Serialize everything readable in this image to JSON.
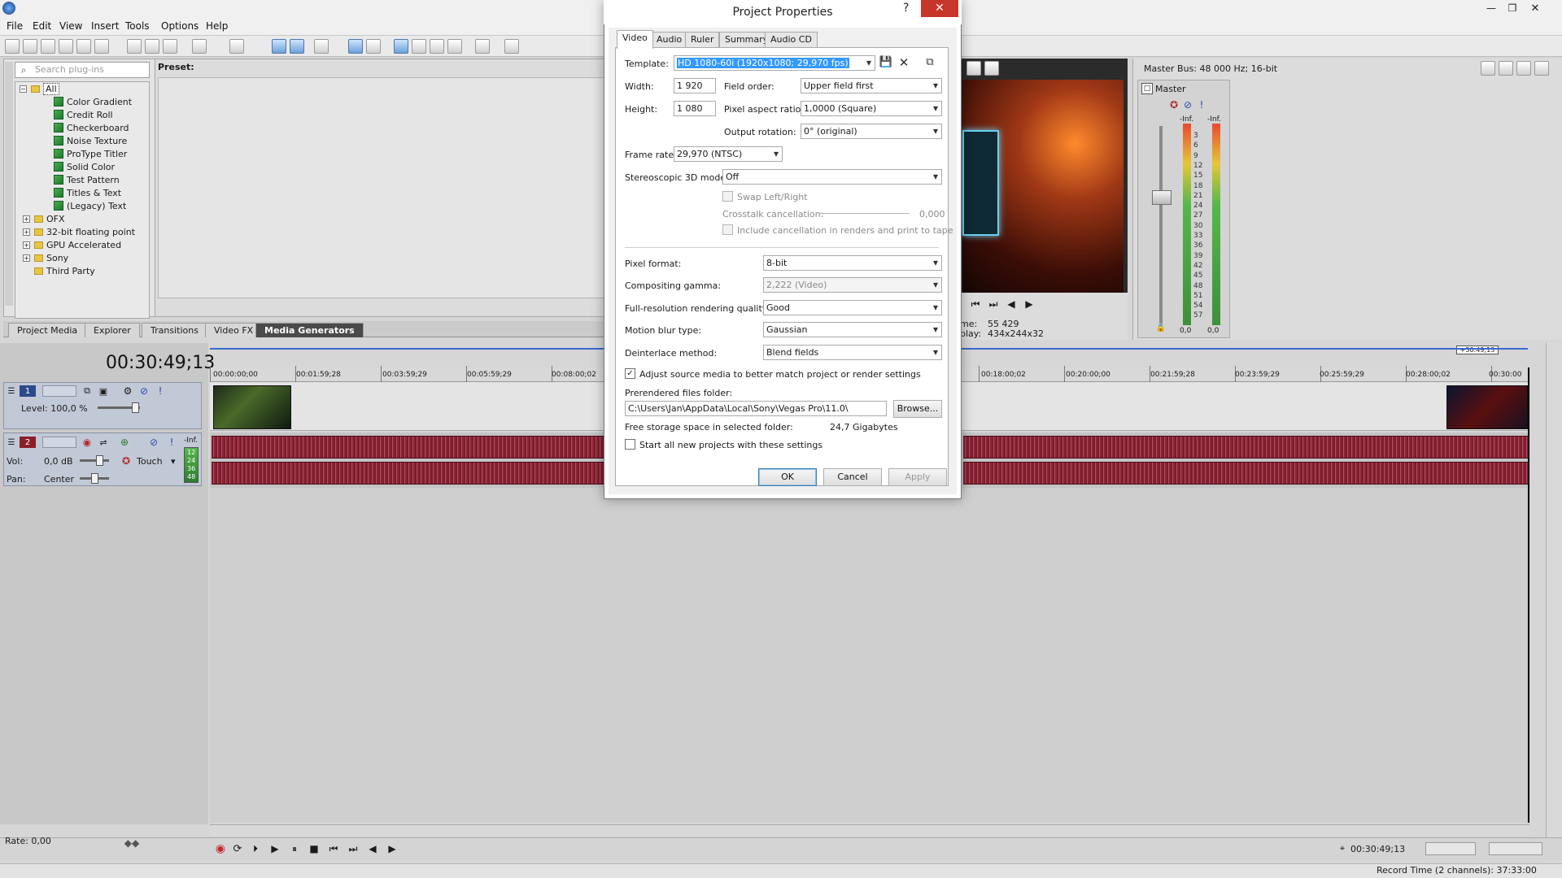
{
  "menu": [
    "File",
    "Edit",
    "View",
    "Insert",
    "Tools",
    "Options",
    "Help"
  ],
  "plugins": {
    "search_placeholder": "Search plug-ins",
    "preset_label": "Preset:",
    "tree": [
      {
        "label": "All",
        "kind": "folder",
        "expanded": true,
        "selected": true
      },
      {
        "label": "Color Gradient",
        "kind": "gen"
      },
      {
        "label": "Credit Roll",
        "kind": "gen"
      },
      {
        "label": "Checkerboard",
        "kind": "gen"
      },
      {
        "label": "Noise Texture",
        "kind": "gen"
      },
      {
        "label": "ProType Titler",
        "kind": "gen"
      },
      {
        "label": "Solid Color",
        "kind": "gen"
      },
      {
        "label": "Test Pattern",
        "kind": "gen"
      },
      {
        "label": "Titles & Text",
        "kind": "gen"
      },
      {
        "label": "(Legacy) Text",
        "kind": "gen"
      },
      {
        "label": "OFX",
        "kind": "folder"
      },
      {
        "label": "32-bit floating point",
        "kind": "folder"
      },
      {
        "label": "GPU Accelerated",
        "kind": "folder"
      },
      {
        "label": "Sony",
        "kind": "folder"
      },
      {
        "label": "Third Party",
        "kind": "folder"
      }
    ]
  },
  "window_tabs": [
    "Project Media",
    "Explorer",
    "Transitions",
    "Video FX",
    "Media Generators"
  ],
  "preview": {
    "frame_label": "me:",
    "frame_value": "55 429",
    "display_label": "play:",
    "display_value": "434x244x32"
  },
  "mixer": {
    "title": "Master Bus: 48 000 Hz; 16-bit",
    "master_label": "Master",
    "inf_left": "-Inf.",
    "inf_right": "-Inf.",
    "db_scale": [
      "3",
      "6",
      "9",
      "12",
      "15",
      "18",
      "21",
      "24",
      "27",
      "30",
      "33",
      "36",
      "39",
      "42",
      "45",
      "48",
      "51",
      "54",
      "57"
    ],
    "zero_left": "0,0",
    "zero_right": "0,0"
  },
  "timeline": {
    "timecode": "00:30:49;13",
    "end_marker": "+30:49;13",
    "ruler": [
      "00:00:00;00",
      "00:01:59;28",
      "00:03:59;29",
      "00:05:59;29",
      "00:08:00;02",
      "00:18:00;02",
      "00:20:00;00",
      "00:21:59;28",
      "00:23:59;29",
      "00:25:59;29",
      "00:28:00;02",
      "00:30:00"
    ],
    "track1": {
      "number": "1",
      "level": "Level: 100,0 %"
    },
    "track2": {
      "number": "2",
      "vol_label": "Vol:",
      "vol_value": "0,0 dB",
      "pan_label": "Pan:",
      "pan_value": "Center",
      "automation": "Touch",
      "inf": "-Inf.",
      "meter": [
        "12",
        "24",
        "36",
        "48"
      ]
    }
  },
  "transport": {
    "rate": "Rate: 0,00",
    "time": "00:30:49;13"
  },
  "status": {
    "record_time": "Record Time (2 channels): 37:33:00"
  },
  "dialog": {
    "title": "Project Properties",
    "help": "?",
    "close": "✕",
    "tabs": [
      "Video",
      "Audio",
      "Ruler",
      "Summary",
      "Audio CD"
    ],
    "template_label": "Template:",
    "template_value": "HD 1080-60i (1920x1080; 29,970 fps)",
    "width_label": "Width:",
    "width_value": "1 920",
    "height_label": "Height:",
    "height_value": "1 080",
    "field_order_label": "Field order:",
    "field_order_value": "Upper field first",
    "par_label": "Pixel aspect ratio:",
    "par_value": "1,0000 (Square)",
    "rotation_label": "Output rotation:",
    "rotation_value": "0° (original)",
    "framerate_label": "Frame rate:",
    "framerate_value": "29,970 (NTSC)",
    "stereo_label": "Stereoscopic 3D mode:",
    "stereo_value": "Off",
    "swap_label": "Swap Left/Right",
    "crosstalk_label": "Crosstalk cancellation:",
    "crosstalk_value": "0,000",
    "include_label": "Include cancellation in renders and print to tape",
    "pixel_format_label": "Pixel format:",
    "pixel_format_value": "8-bit",
    "gamma_label": "Compositing gamma:",
    "gamma_value": "2,222 (Video)",
    "quality_label": "Full-resolution rendering quality:",
    "quality_value": "Good",
    "blur_label": "Motion blur type:",
    "blur_value": "Gaussian",
    "deinterlace_label": "Deinterlace method:",
    "deinterlace_value": "Blend fields",
    "adjust_label": "Adjust source media to better match project or render settings",
    "adjust_checked": "✓",
    "prerender_label": "Prerendered files folder:",
    "prerender_value": "C:\\Users\\Jan\\AppData\\Local\\Sony\\Vegas Pro\\11.0\\",
    "browse": "Browse...",
    "free_label": "Free storage space in selected folder:",
    "free_value": "24,7 Gigabytes",
    "start_label": "Start all new projects with these settings",
    "ok": "OK",
    "cancel": "Cancel",
    "apply": "Apply"
  }
}
